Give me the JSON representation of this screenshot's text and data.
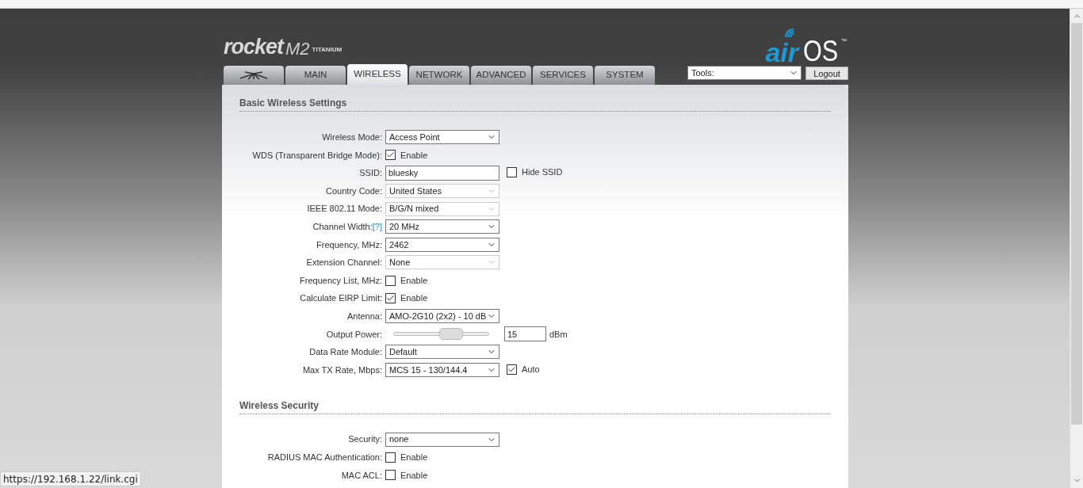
{
  "logo": {
    "product": "rocket",
    "model": "M2",
    "edition": "TITANIUM"
  },
  "brand": {
    "air": "air",
    "os": "OS",
    "tm": "™"
  },
  "tabs": [
    {
      "kind": "icon",
      "selected": false
    },
    {
      "kind": "text",
      "label": "MAIN",
      "selected": false
    },
    {
      "kind": "text",
      "label": "WIRELESS",
      "selected": true
    },
    {
      "kind": "text",
      "label": "NETWORK",
      "selected": false
    },
    {
      "kind": "text",
      "label": "ADVANCED",
      "selected": false
    },
    {
      "kind": "text",
      "label": "SERVICES",
      "selected": false
    },
    {
      "kind": "text",
      "label": "SYSTEM",
      "selected": false
    }
  ],
  "tools": {
    "value": "Tools:"
  },
  "logout": "Logout",
  "sections": [
    {
      "title": "Basic Wireless Settings",
      "rows": [
        {
          "label": "Wireless Mode:",
          "kind": "select",
          "value": "Access Point",
          "disabled": false
        },
        {
          "label": "WDS (Transparent Bridge Mode):",
          "kind": "checkbox",
          "checked": true,
          "text": "Enable"
        },
        {
          "label": "SSID:",
          "kind": "text",
          "value": "bluesky",
          "extra": {
            "kind": "checkbox",
            "checked": false,
            "text": "Hide SSID"
          }
        },
        {
          "label": "Country Code:",
          "kind": "select",
          "value": "United States",
          "disabled": true
        },
        {
          "label": "IEEE 802.11 Mode:",
          "kind": "select",
          "value": "B/G/N mixed",
          "disabled": true
        },
        {
          "label": "Channel Width:",
          "help": "[?]",
          "kind": "select",
          "value": "20 MHz",
          "disabled": false
        },
        {
          "label": "Frequency, MHz:",
          "kind": "select",
          "value": "2462",
          "disabled": false
        },
        {
          "label": "Extension Channel:",
          "kind": "select",
          "value": "None",
          "disabled": true
        },
        {
          "label": "Frequency List, MHz:",
          "kind": "checkbox",
          "checked": false,
          "text": "Enable"
        },
        {
          "label": "Calculate EIRP Limit:",
          "kind": "checkbox",
          "checked": true,
          "text": "Enable"
        },
        {
          "label": "Antenna:",
          "kind": "select",
          "value": "AMO-2G10 (2x2) - 10 dB",
          "disabled": false
        },
        {
          "label": "Output Power:",
          "kind": "slider",
          "level": 0.6,
          "value": "15",
          "unit": "dBm"
        },
        {
          "label": "Data Rate Module:",
          "kind": "select",
          "value": "Default",
          "disabled": false
        },
        {
          "label": "Max TX Rate, Mbps:",
          "kind": "select",
          "value": "MCS 15 - 130/144.4",
          "disabled": false,
          "extra": {
            "kind": "checkbox",
            "checked": true,
            "text": "Auto"
          }
        }
      ]
    },
    {
      "title": "Wireless Security",
      "rows": [
        {
          "label": "Security:",
          "kind": "select",
          "value": "none",
          "disabled": false
        },
        {
          "label": "RADIUS MAC Authentication:",
          "kind": "checkbox",
          "checked": false,
          "text": "Enable"
        },
        {
          "label": "MAC ACL:",
          "kind": "checkbox",
          "checked": false,
          "text": "Enable"
        }
      ]
    }
  ],
  "status_url": "https://192.168.1.22/link.cgi"
}
